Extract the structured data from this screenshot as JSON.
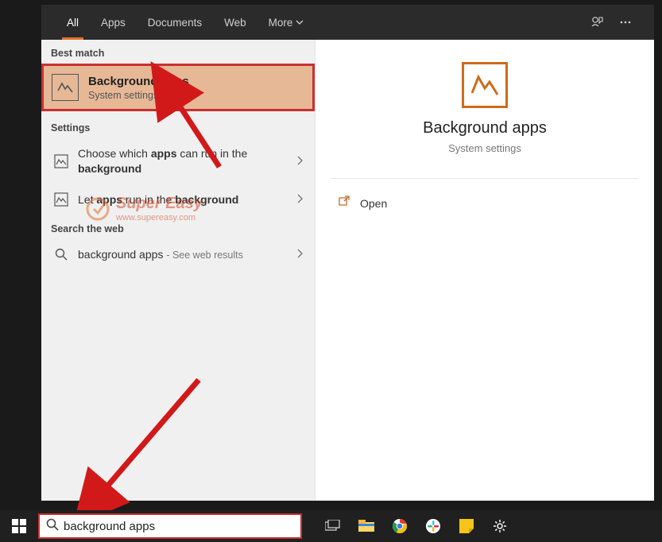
{
  "tabs": {
    "all": "All",
    "apps": "Apps",
    "documents": "Documents",
    "web": "Web",
    "more": "More"
  },
  "sections": {
    "best_match": "Best match",
    "settings": "Settings",
    "search_web": "Search the web"
  },
  "best_match": {
    "title": "Background apps",
    "subtitle": "System settings"
  },
  "settings_items": [
    {
      "pre": "Choose which ",
      "b1": "apps",
      "mid": " can run in the ",
      "b2": "background"
    },
    {
      "pre": "Let ",
      "b1": "apps",
      "mid": " run in the ",
      "b2": "background"
    }
  ],
  "web_item": {
    "query": "background apps",
    "suffix": "See web results"
  },
  "detail": {
    "title": "Background apps",
    "subtitle": "System settings",
    "open": "Open"
  },
  "search": {
    "value": "background apps"
  },
  "watermark": {
    "line1": "Super Easy",
    "line2": "www.supereasy.com"
  }
}
